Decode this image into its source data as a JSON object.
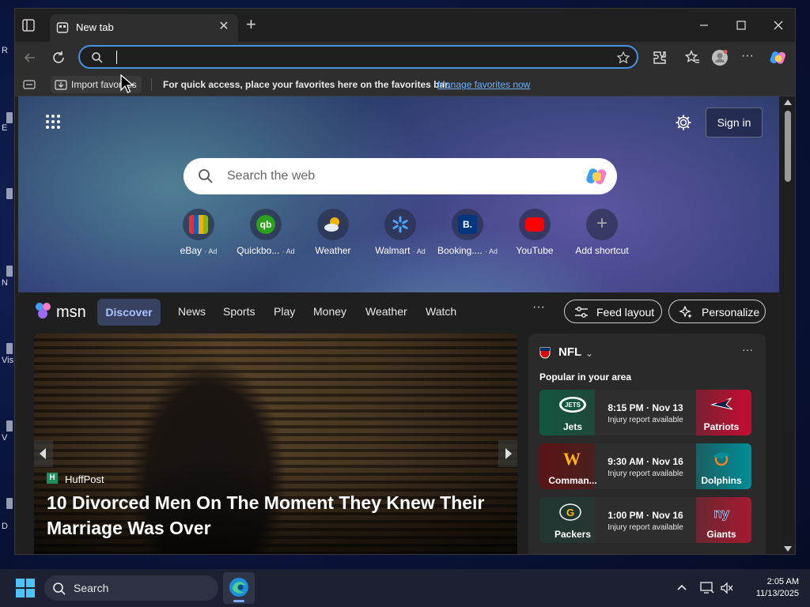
{
  "desktop": {
    "edge_letters": [
      "R",
      "E",
      "N",
      "Vis",
      "V",
      "D"
    ]
  },
  "browser": {
    "tab": {
      "title": "New tab"
    },
    "address": {
      "value": "",
      "placeholder": ""
    },
    "favorites_bar": {
      "import_label": "Import favorites",
      "hint": "For quick access, place your favorites here on the favorites bar.",
      "manage_link": "Manage favorites now"
    }
  },
  "newtab": {
    "sign_in": "Sign in",
    "search_placeholder": "Search the web",
    "shortcuts": [
      {
        "label": "eBay",
        "ad": "· Ad",
        "icon": "ebay-icon",
        "color": "#2f6bdc"
      },
      {
        "label": "Quickbo...",
        "ad": "· Ad",
        "icon": "quickbooks-icon",
        "color": "#2ca01c"
      },
      {
        "label": "Weather",
        "ad": "",
        "icon": "weather-icon",
        "color": "#f5b400"
      },
      {
        "label": "Walmart",
        "ad": "· Ad",
        "icon": "walmart-icon",
        "color": "#0071ce"
      },
      {
        "label": "Booking....",
        "ad": "· Ad",
        "icon": "booking-icon",
        "color": "#003580"
      },
      {
        "label": "YouTube",
        "ad": "",
        "icon": "youtube-icon",
        "color": "#ff0000"
      },
      {
        "label": "Add shortcut",
        "ad": "",
        "icon": "plus-icon",
        "color": "#888888"
      }
    ]
  },
  "feed": {
    "brand": "msn",
    "nav": [
      "Discover",
      "News",
      "Sports",
      "Play",
      "Money",
      "Weather",
      "Watch"
    ],
    "more": "···",
    "feed_layout": "Feed layout",
    "personalize": "Personalize",
    "hero": {
      "source_badge": "H",
      "source": "HuffPost",
      "headline": "10 Divorced Men On The Moment They Knew Their Marriage Was Over"
    },
    "sports": {
      "league": "NFL",
      "subtitle": "Popular in your area",
      "games": [
        {
          "left": "Jets",
          "right": "Patriots",
          "time": "8:15 PM · Nov 13",
          "note": "Injury report available",
          "lcolor": "#125740",
          "rcolor": "#c60c30"
        },
        {
          "left": "Comman...",
          "right": "Dolphins",
          "time": "9:30 AM · Nov 16",
          "note": "Injury report available",
          "lcolor": "#5a1414",
          "rcolor": "#008e97"
        },
        {
          "left": "Packers",
          "right": "Giants",
          "time": "1:00 PM · Nov 16",
          "note": "Injury report available",
          "lcolor": "#203731",
          "rcolor": "#a71930"
        }
      ]
    }
  },
  "taskbar": {
    "search": "Search",
    "time": "2:05 AM",
    "date": "11/13/2025"
  }
}
